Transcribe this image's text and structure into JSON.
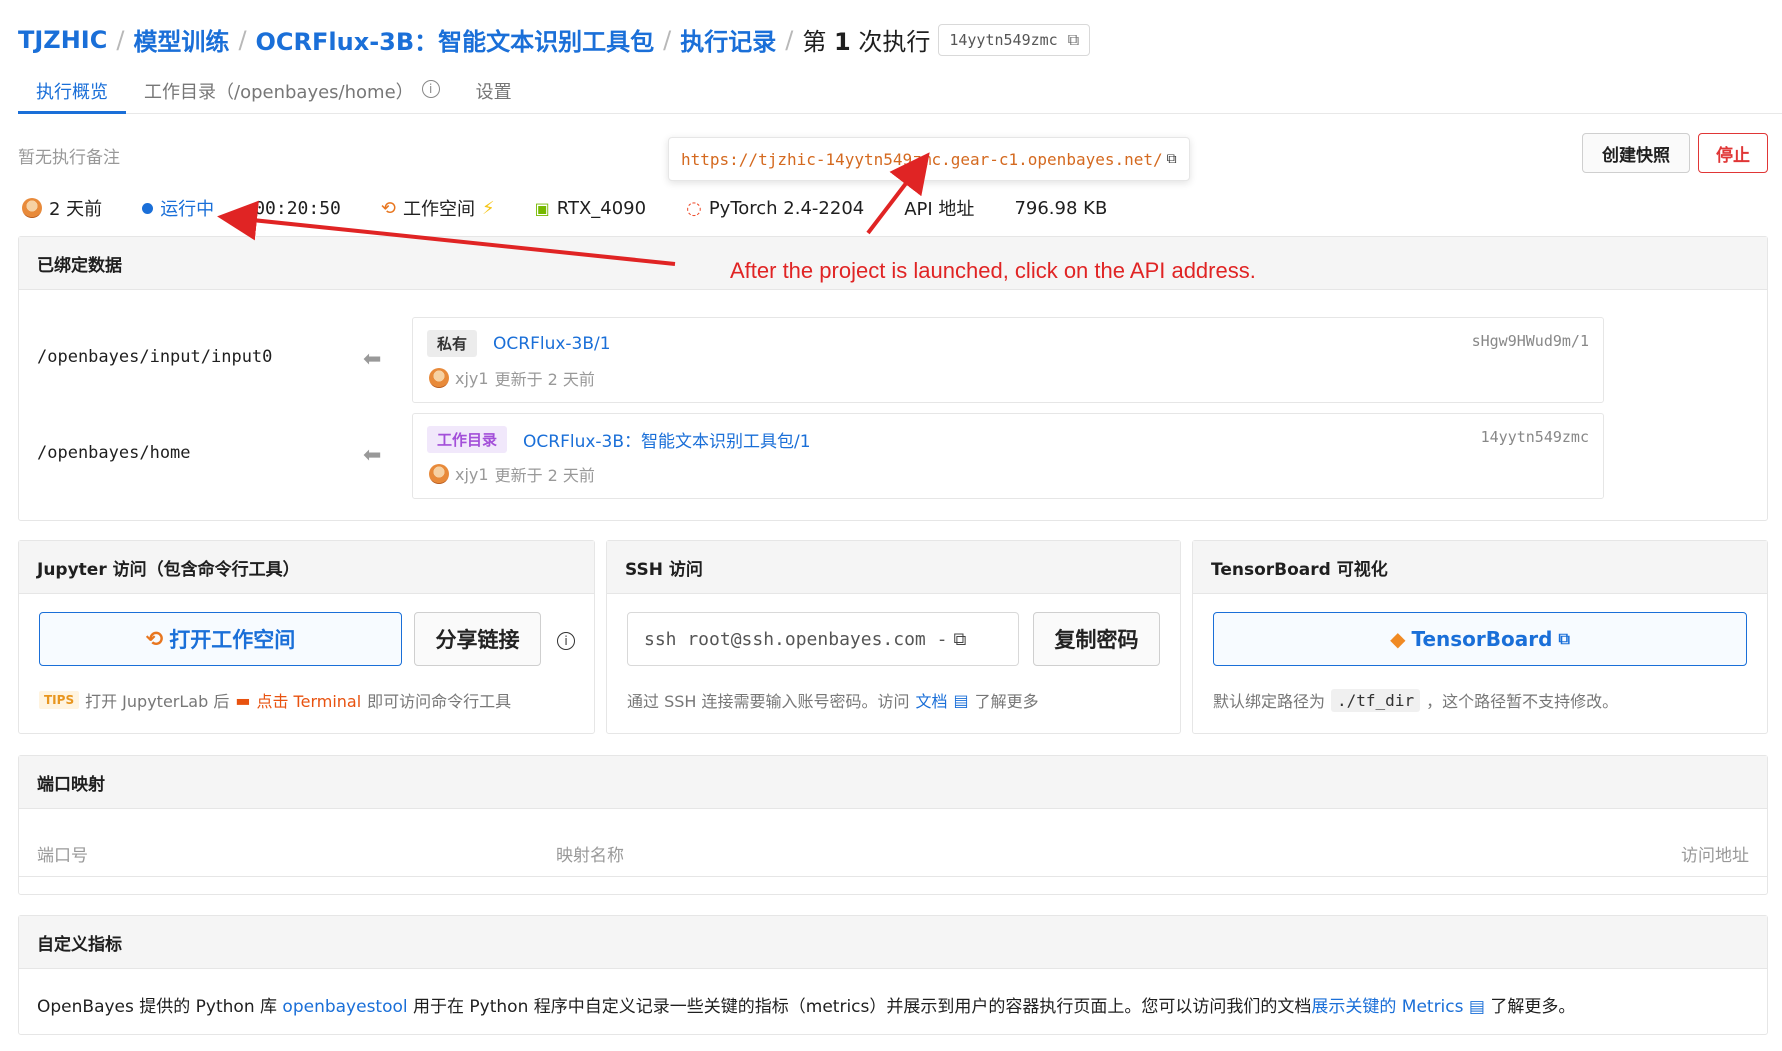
{
  "breadcrumb": {
    "org": "TJZHIC",
    "project": "模型训练",
    "model": "OCRFlux-3B：智能文本识别工具包",
    "records": "执行记录",
    "current_prefix": "第",
    "current_num": "1",
    "current_suffix": "次执行",
    "run_id": "14yytn549zmc"
  },
  "tabs": [
    {
      "label": "执行概览",
      "active": true
    },
    {
      "label": "工作目录（/openbayes/home）",
      "active": false
    },
    {
      "label": "设置",
      "active": false
    }
  ],
  "note": "暂无执行备注",
  "actions": {
    "snapshot": "创建快照",
    "stop": "停止"
  },
  "url_popover": "https://tjzhic-14yytn549zmc.gear-c1.openbayes.net/",
  "stats": {
    "time_ago": "2 天前",
    "status": "运行中",
    "duration": "00:20:50",
    "workspace": "工作空间",
    "gpu": "RTX_4090",
    "framework": "PyTorch 2.4-2204",
    "api": "API 地址",
    "size": "796.98 KB"
  },
  "bound_data": {
    "title": "已绑定数据",
    "rows": [
      {
        "path": "/openbayes/input/input0",
        "tag": "私有",
        "name": "OCRFlux-3B/1",
        "user": "xjy1",
        "updated": "更新于 2 天前",
        "id": "sHgw9HWud9m/1"
      },
      {
        "path": "/openbayes/home",
        "tag": "工作目录",
        "name": "OCRFlux-3B：智能文本识别工具包/1",
        "user": "xjy1",
        "updated": "更新于 2 天前",
        "id": "14yytn549zmc"
      }
    ]
  },
  "jupyter": {
    "title": "Jupyter 访问（包含命令行工具）",
    "open_btn": "打开工作空间",
    "share_btn": "分享链接",
    "tips": "TIPS",
    "hint_a": "打开 JupyterLab 后",
    "hint_b": "点击 Terminal",
    "hint_c": "即可访问命令行工具"
  },
  "ssh": {
    "title": "SSH 访问",
    "command": "ssh root@ssh.openbayes.com -",
    "copy_btn": "复制密码",
    "hint_a": "通过 SSH 连接需要输入账号密码。访问",
    "hint_link": "文档",
    "hint_b": "了解更多"
  },
  "tensorboard": {
    "title": "TensorBoard 可视化",
    "btn": "TensorBoard",
    "hint_a": "默认绑定路径为",
    "hint_code": "./tf_dir",
    "hint_b": "，这个路径暂不支持修改。"
  },
  "ports": {
    "title": "端口映射",
    "col_port": "端口号",
    "col_name": "映射名称",
    "col_addr": "访问地址"
  },
  "metrics": {
    "title": "自定义指标",
    "text_a": "OpenBayes 提供的 Python 库",
    "link_a": "openbayestool",
    "text_b": "用于在 Python 程序中自定义记录一些关键的指标（metrics）并展示到用户的容器执行页面上。您可以访问我们的文档",
    "link_b": "展示关键的 Metrics",
    "text_c": "了解更多。"
  },
  "annotation": "After the project is launched, click on the API address.",
  "colors": {
    "accent": "#1a6fd8",
    "stop": "#e03636",
    "annotation": "#e02424",
    "url": "#d4691f"
  }
}
